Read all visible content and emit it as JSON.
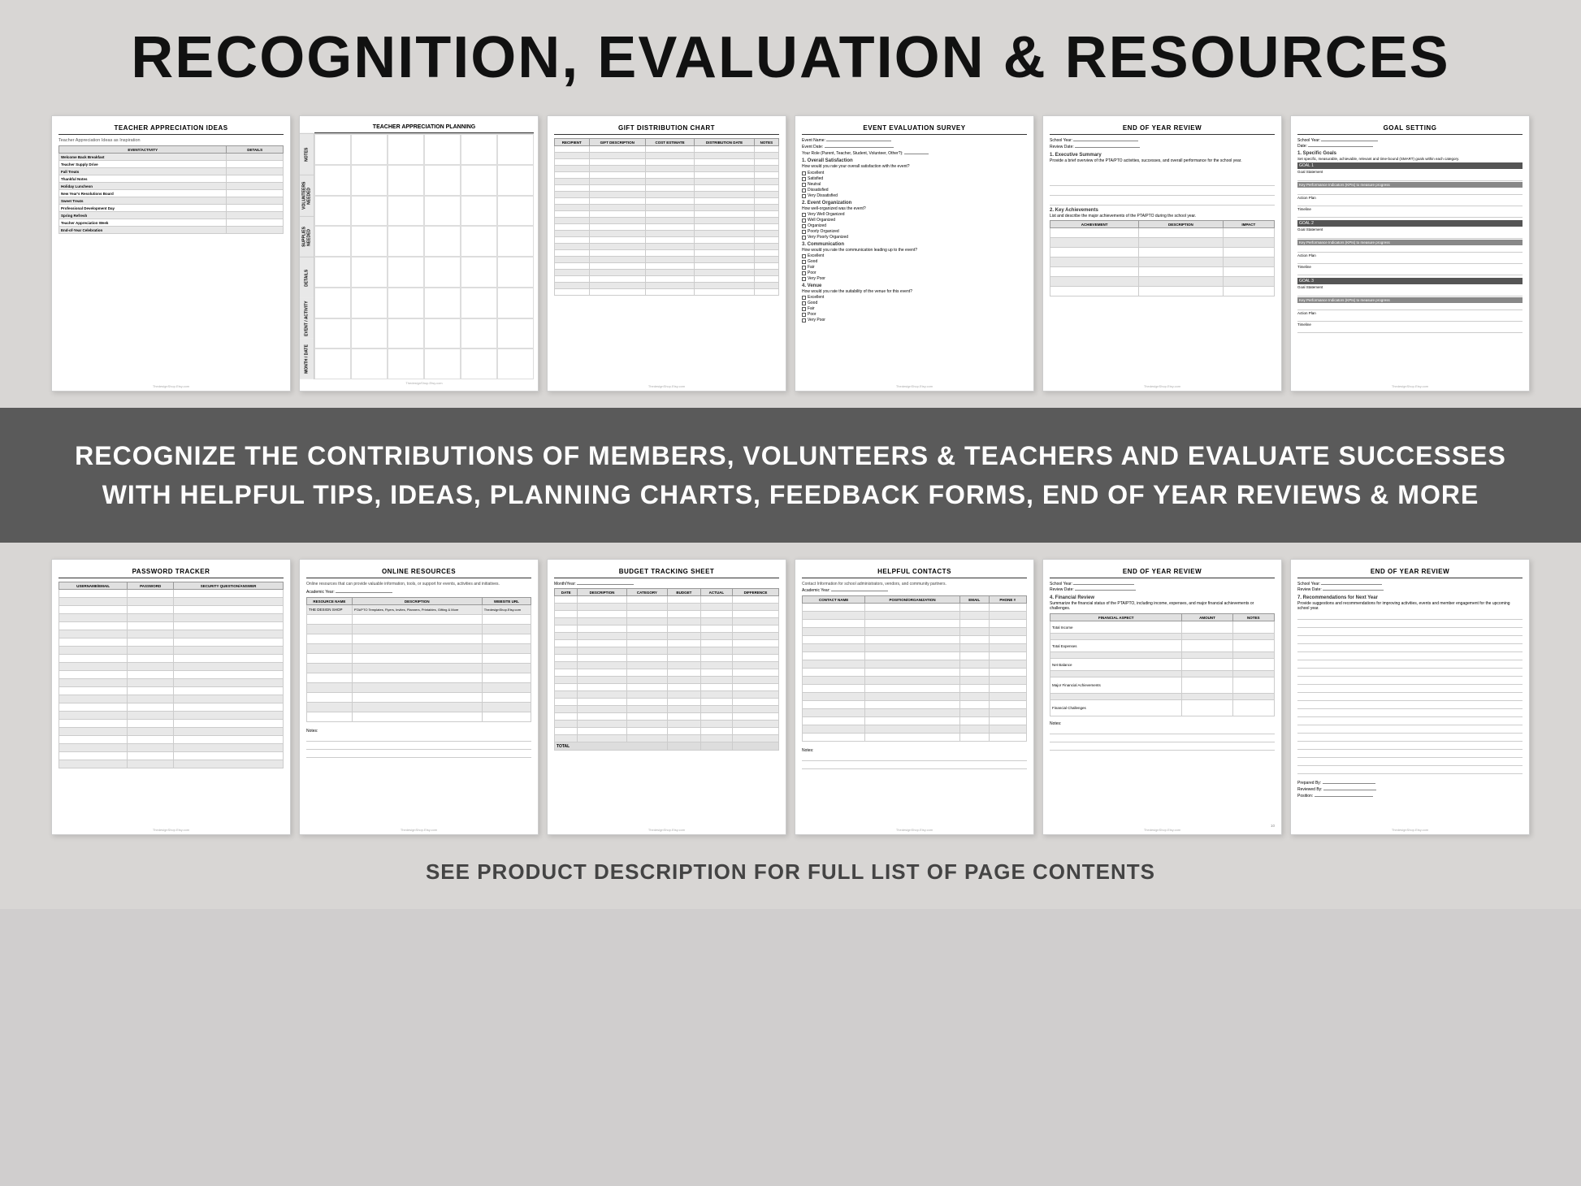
{
  "header": {
    "title": "RECOGNITION, EVALUATION & RESOURCES"
  },
  "banner": {
    "text": "RECOGNIZE THE CONTRIBUTIONS OF MEMBERS, VOLUNTEERS & TEACHERS AND EVALUATE SUCCESSES WITH HELPFUL TIPS, IDEAS, PLANNING CHARTS, FEEDBACK FORMS, END OF YEAR REVIEWS & MORE"
  },
  "footer": {
    "text": "SEE PRODUCT DESCRIPTION FOR FULL LIST OF PAGE CONTENTS"
  },
  "top_docs": [
    {
      "id": "teacher-appreciation",
      "title": "TEACHER APPRECIATION IDEAS",
      "subtitle": "Teacher Appreciation Ideas as Inspiration"
    },
    {
      "id": "teacher-planning",
      "title": "TEACHER APPRECIATION PLANNING",
      "vertical": true
    },
    {
      "id": "gift-distribution",
      "title": "GIFT DISTRIBUTION CHART",
      "columns": [
        "RECIPIENT",
        "GIFT DESCRIPTION",
        "COST ESTIMATE",
        "DISTRIBUTION DATE",
        "NOTES"
      ]
    },
    {
      "id": "event-evaluation",
      "title": "EVENT EVALUATION SURVEY",
      "fields": [
        "Event Name:",
        "Event Date:",
        "Your Role (Parent, Teacher, Student, Volunteer, Other?)"
      ]
    },
    {
      "id": "end-of-year-review-1",
      "title": "END OF YEAR REVIEW",
      "fields": [
        "School Year:",
        "Review Date:"
      ]
    },
    {
      "id": "goal-setting",
      "title": "GOAL SETTING",
      "fields": [
        "School Year:",
        "Date:"
      ]
    }
  ],
  "bottom_docs": [
    {
      "id": "password-tracker",
      "title": "PASSWORD TRACKER",
      "columns": [
        "USERNAME/EMAIL",
        "PASSWORD",
        "SECURITY QUESTION/ANSWER"
      ]
    },
    {
      "id": "online-resources",
      "title": "ONLINE RESOURCES",
      "subtitle": "Online resources that can provide valuable information, tools, or support for events, activities and initiatives.",
      "columns": [
        "RESOURCE NAME",
        "DESCRIPTION",
        "WEBSITE URL"
      ]
    },
    {
      "id": "budget-tracking",
      "title": "BUDGET TRACKING SHEET",
      "subtitle": "Month/Year:",
      "columns": [
        "DATE",
        "DESCRIPTION",
        "CATEGORY",
        "BUDGET",
        "ACTUAL",
        "DIFFERENCE"
      ]
    },
    {
      "id": "helpful-contacts",
      "title": "HELPFUL CONTACTS",
      "subtitle": "Contact Information for school administrators, vendors, and community partners.",
      "columns": [
        "CONTACT NAME",
        "POSITION/ORGANIZATION",
        "EMAIL",
        "PHONE #"
      ]
    },
    {
      "id": "end-of-year-review-2",
      "title": "END OF YEAR REVIEW",
      "fields": [
        "School Year:",
        "Review Date:"
      ]
    },
    {
      "id": "end-of-year-review-3",
      "title": "END OF YEAR REVIEW",
      "fields": [
        "School Year:",
        "Review Date:"
      ]
    }
  ],
  "watermark": "ThedesignShop.Etsy.com"
}
